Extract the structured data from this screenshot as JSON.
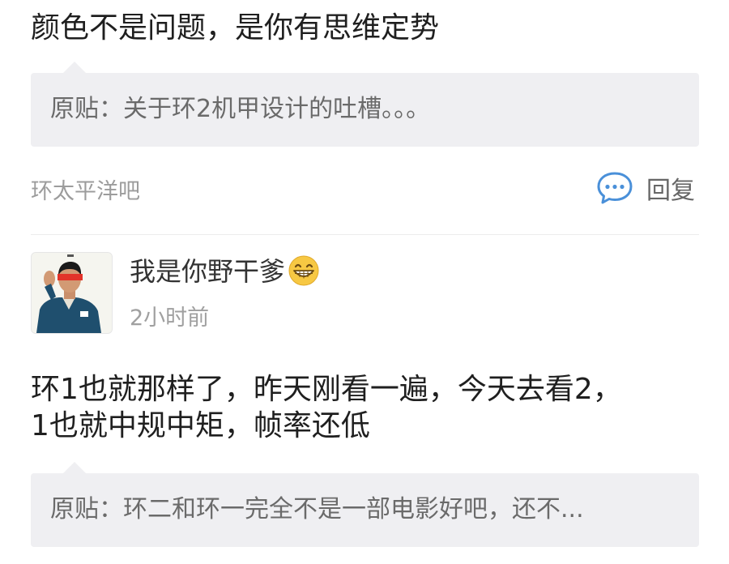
{
  "post1": {
    "text": "颜色不是问题，是你有思维定势",
    "quote": "原贴：关于环2机甲设计的吐槽。。。",
    "forum": "环太平洋吧",
    "reply_label": "回复"
  },
  "post2": {
    "username": "我是你野干爹",
    "username_emoji": "grinning-emoji-icon",
    "time": "2小时前",
    "text_line1": "环1也就那样了，昨天刚看一遍，今天去看2，",
    "text_line2": "1也就中规中矩，帧率还低",
    "quote": "原贴：环二和环一完全不是一部电影好吧，还不..."
  },
  "colors": {
    "accent_blue": "#4a90d9",
    "quote_bg": "#efeff2",
    "secondary_text": "#9c9c9c"
  }
}
